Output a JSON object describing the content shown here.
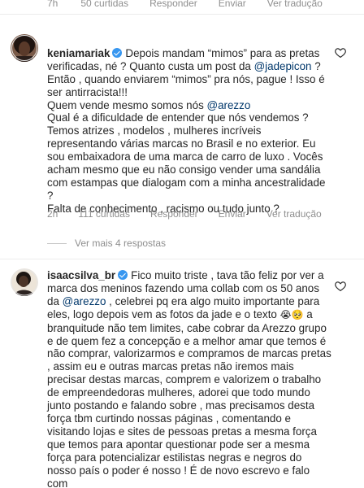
{
  "top_actions": {
    "time": "7h",
    "likes": "50 curtidas",
    "reply": "Responder",
    "send": "Enviar",
    "translate": "Ver tradução"
  },
  "comment1": {
    "username": "keniamariak",
    "paragraphs": [
      "Depois mandam “mimos” para as pretas verificadas, né ? Quanto custa um post da ",
      " ? Então , quando enviarem “mimos” pra nós, pague ! Isso é ser antirracista!!!",
      "Quem vende mesmo somos nós ",
      "Qual é a dificuldade de entender que nós vendemos ? Temos atrizes , modelos , mulheres incríveis representando várias marcas no Brasil e no exterior. Eu sou embaixadora de uma marca de carro de luxo . Vocês acham mesmo que eu não consigo vender uma sandália com estampas que dialogam com a minha ancestralidade ?",
      "Falta de conhecimento ,  racismo ou tudo junto ?"
    ],
    "mention_jade": "@jadepicon",
    "mention_arezzo": "@arezzo",
    "time": "2h",
    "likes": "111 curtidas",
    "reply": "Responder",
    "send": "Enviar",
    "translate": "Ver tradução"
  },
  "more_replies": "Ver mais 4 respostas",
  "comment2": {
    "username": "isaacsilva_br",
    "text_a": "Fico muito triste , tava tão feliz por ver a marca dos meninos fazendo uma collab com os 50 anos da ",
    "mention_arezzo": "@arezzo",
    "text_b": " , celebrei pq era algo muito importante para eles, logo depois vem as fotos da jade e o texto ",
    "emojis": "😭🥺",
    "text_c": " a branquitude não tem limites, cabe cobrar da Arezzo grupo e de quem fez a concepção e a melhor amar que temos é não comprar, valorizarmos e compramos de marcas pretas , assim eu e outras marcas pretas não iremos mais precisar destas marcas, comprem e valorizem o trabalho de empreendedoras mulheres, adorei que todo mundo junto postando e falando sobre , mas precisamos desta força tbm curtindo nossas páginas , comentando e visitando lojas e sites de pessoas pretas a mesma força que temos para apontar questionar pode ser a mesma força para potencializar estilistas negras e negros do nosso país o poder é nosso ! É de novo escrevo e falo com"
  },
  "colors": {
    "text": "#262626",
    "secondary": "#8e8e8e",
    "mention": "#00376b",
    "verified": "#3897f0"
  },
  "icons": {
    "verified": "verified-badge-icon",
    "like": "heart-outline-icon"
  }
}
